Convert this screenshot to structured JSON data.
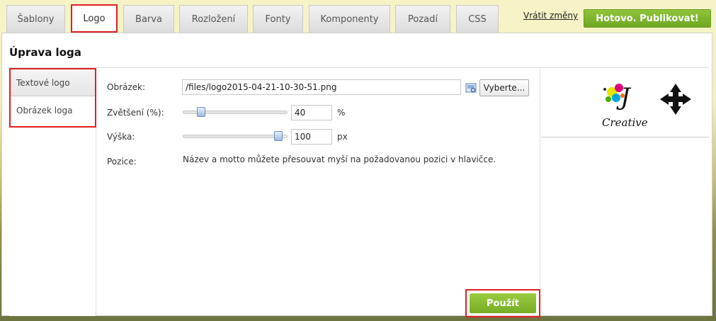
{
  "tabs": [
    {
      "label": "Šablony"
    },
    {
      "label": "Logo"
    },
    {
      "label": "Barva"
    },
    {
      "label": "Rozložení"
    },
    {
      "label": "Fonty"
    },
    {
      "label": "Komponenty"
    },
    {
      "label": "Pozadí"
    },
    {
      "label": "CSS"
    }
  ],
  "header": {
    "revert_label": "Vrátit změny",
    "publish_label": "Hotovo. Publikovat!"
  },
  "panel": {
    "title": "Úprava loga"
  },
  "leftnav": {
    "items": [
      {
        "label": "Textové logo"
      },
      {
        "label": "Obrázek loga"
      }
    ]
  },
  "form": {
    "image_label": "Obrázek:",
    "image_value": "/files/logo2015-04-21-10-30-51.png",
    "select_button": "Vyberte...",
    "zoom_label": "Zvětšení (%):",
    "zoom_value": "40",
    "zoom_unit": "%",
    "zoom_level": 0.15,
    "height_label": "Výška:",
    "height_value": "100",
    "height_unit": "px",
    "height_level": 0.95,
    "position_label": "Pozice:",
    "position_text": "Název a motto můžete přesouvat myší na požadovanou pozici v hlavičce.",
    "apply_label": "Použít"
  },
  "preview": {
    "logo_letter": "J",
    "logo_text": "Creative"
  },
  "colors": {
    "accent_green": "#7ab22b",
    "highlight_red": "#e02020"
  }
}
